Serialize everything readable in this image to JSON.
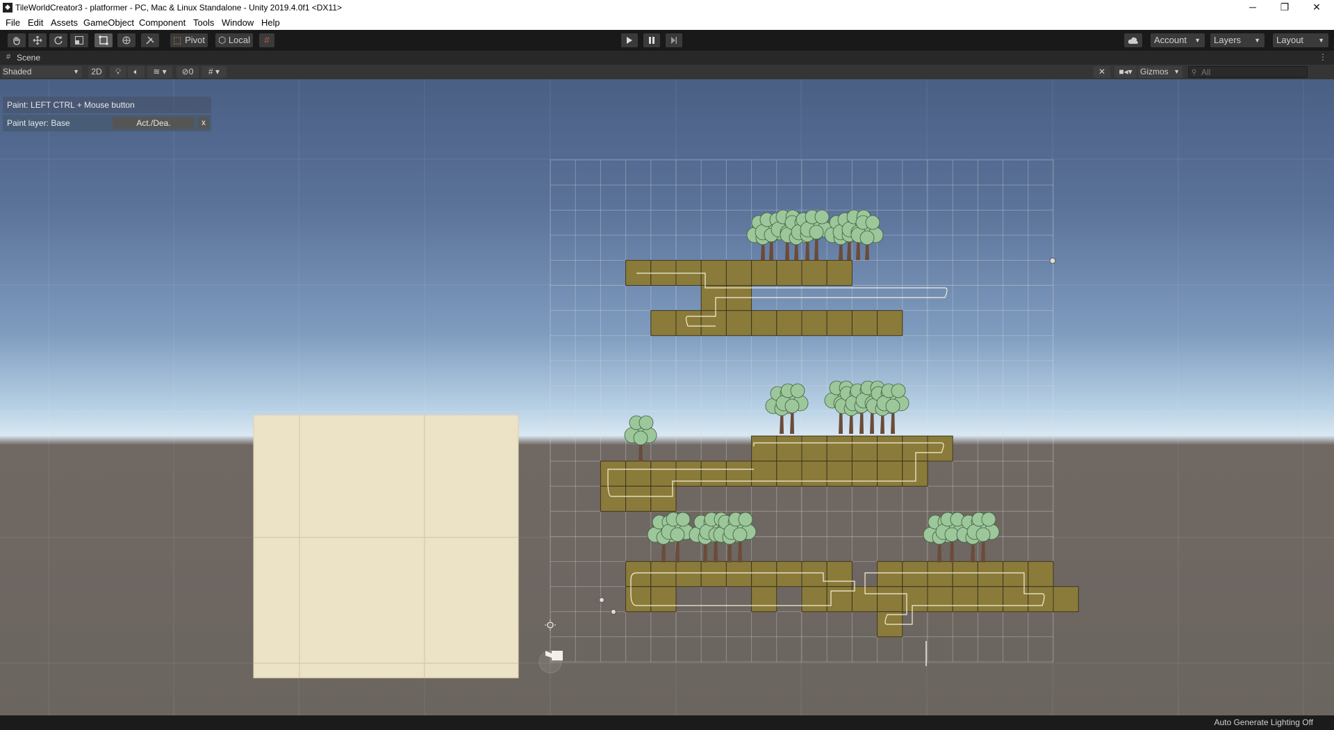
{
  "window": {
    "title": "TileWorldCreator3 - platformer - PC, Mac & Linux Standalone - Unity 2019.4.0f1 <DX11>",
    "controls": {
      "minimize": "─",
      "restore": "❐",
      "close": "✕"
    }
  },
  "menu": [
    "File",
    "Edit",
    "Assets",
    "GameObject",
    "Component",
    "Tools",
    "Window",
    "Help"
  ],
  "toolbar": {
    "pivot_label": "Pivot",
    "local_label": "Local",
    "account_label": "Account",
    "layers_label": "Layers",
    "layout_label": "Layout"
  },
  "scene": {
    "tab_label": "Scene",
    "shading_mode": "Shaded",
    "mode_2d": "2D",
    "hidden_count": "0",
    "gizmos_label": "Gizmos",
    "search_placeholder": "All"
  },
  "paint_overlay": {
    "hint": "Paint: LEFT CTRL + Mouse button",
    "layer_label": "Paint layer: Base",
    "toggle_label": "Act./Dea.",
    "close_label": "x"
  },
  "status": {
    "lighting": "Auto Generate Lighting Off"
  },
  "colors": {
    "tile": "#8b7b3a",
    "sky_top": "#4a5f84",
    "ground": "#6b6560",
    "selection_panel": "#ece2c6"
  }
}
